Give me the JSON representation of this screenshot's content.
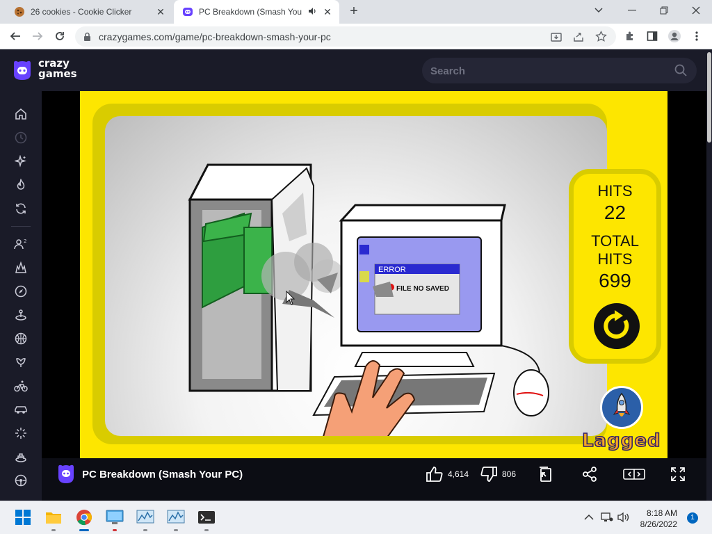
{
  "browser": {
    "tabs": [
      {
        "title": "26 cookies - Cookie Clicker",
        "active": false
      },
      {
        "title": "PC Breakdown (Smash Your PC)",
        "active": true
      }
    ],
    "url": "crazygames.com/game/pc-breakdown-smash-your-pc"
  },
  "site": {
    "logo_line1": "crazy",
    "logo_line2": "games",
    "search_placeholder": "Search",
    "sidebar_icons": [
      "home-icon",
      "recent-icon",
      "new-icon",
      "trending-icon",
      "updated-icon",
      "multiplayer-icon",
      "action-icon",
      "adventure-icon",
      "puzzle-icon",
      "basketball-icon",
      "casual-icon",
      "bike-icon",
      "car-icon",
      "clicker-icon",
      "driving-icon",
      "controller-icon"
    ]
  },
  "game": {
    "hits_label": "HITS",
    "hits_value": "22",
    "total_hits_label": "TOTAL HITS",
    "total_hits_value": "699",
    "error_title": "ERROR",
    "error_message": "FILE NO SAVED",
    "publisher": "Lagged",
    "colors": {
      "background": "#fde600",
      "frame": "#d9cc00",
      "screen_blue": "#9999f0"
    }
  },
  "gamebar": {
    "title": "PC Breakdown (Smash Your PC)",
    "likes": "4,614",
    "dislikes": "806"
  },
  "taskbar": {
    "time": "8:18 AM",
    "date": "8/26/2022",
    "notifications": "1"
  }
}
